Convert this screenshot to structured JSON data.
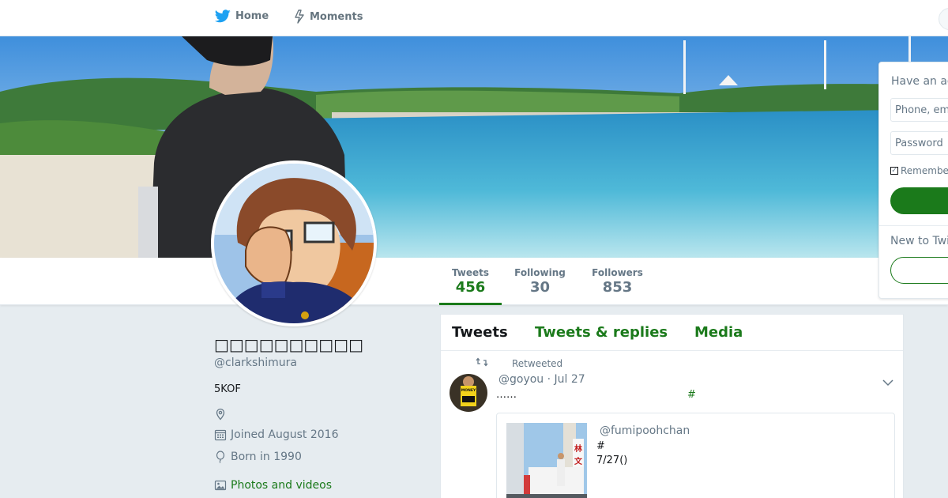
{
  "nav": {
    "home_label": "Home",
    "moments_label": "Moments",
    "brand_color": "#1da1f2"
  },
  "profile": {
    "name": "□□□□□□□□□□",
    "handle": "@clarkshimura",
    "bio": "5KOF",
    "location": "",
    "joined": "Joined August 2016",
    "born": "Born in 1990",
    "photos_label": "Photos and videos"
  },
  "stats": {
    "tweets_label": "Tweets",
    "tweets_value": "456",
    "following_label": "Following",
    "following_value": "30",
    "followers_label": "Followers",
    "followers_value": "853"
  },
  "timeline": {
    "tabs": [
      {
        "label": "Tweets",
        "active": true
      },
      {
        "label": "Tweets & replies",
        "active": false
      },
      {
        "label": "Media",
        "active": false
      }
    ],
    "tweet": {
      "retweeted_label": "Retweeted",
      "handle": "@goyou",
      "date": "Jul 27",
      "text": "……",
      "hashtag": "#",
      "quote": {
        "handle": "@fumipoohchan",
        "line1": "#",
        "line2": "7/27()"
      },
      "avatar_sign_text": "MONEY FOR"
    }
  },
  "login": {
    "heading": "Have an account?",
    "phone_placeholder": "Phone, email or username",
    "password_placeholder": "Password",
    "remember_label": "Remember me",
    "new_label": "New to Twitter?"
  },
  "colors": {
    "accent": "#1b7a1b",
    "muted_text": "#657786",
    "page_bg": "#e6ecf0"
  }
}
